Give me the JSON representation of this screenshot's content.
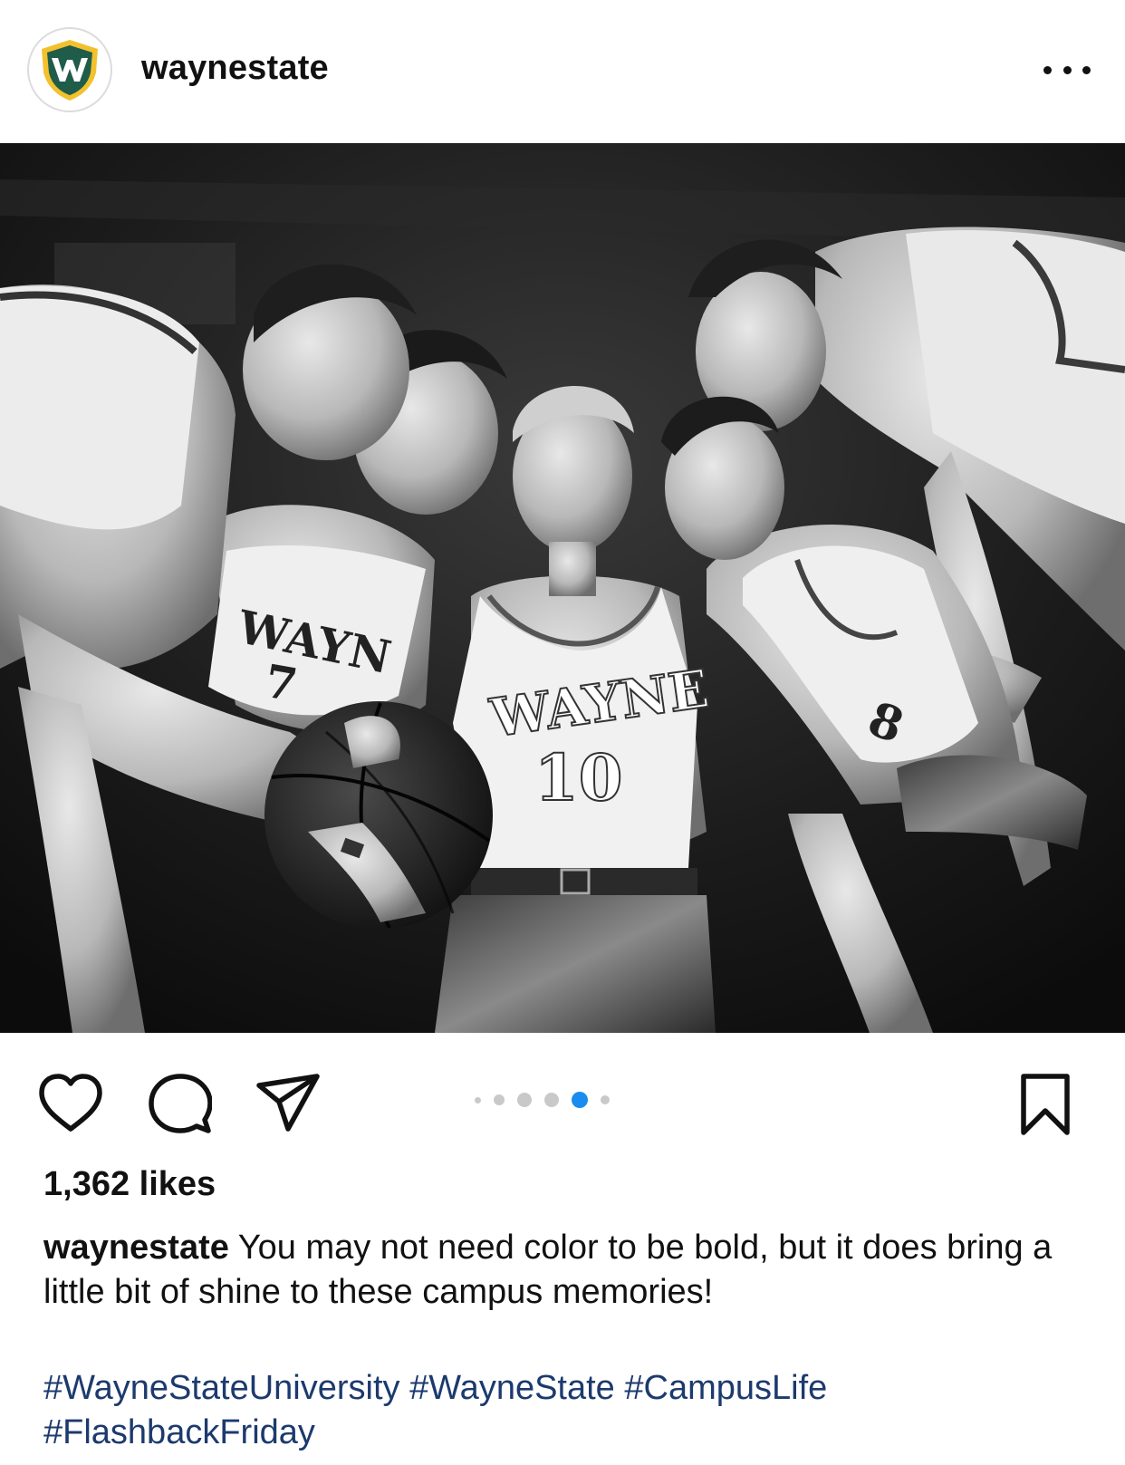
{
  "post": {
    "username": "waynestate",
    "avatar_icon": "wayne-state-w-shield-logo",
    "more_icon": "more-options-icon"
  },
  "photo": {
    "jersey_text_center": "WAYNE",
    "jersey_number_center": "10",
    "jersey_text_left": "WAYN",
    "jersey_number_left": "7",
    "jersey_number_right": "8"
  },
  "actions": {
    "like_icon": "heart-icon",
    "comment_icon": "comment-bubble-icon",
    "share_icon": "paper-plane-icon",
    "save_icon": "bookmark-icon",
    "carousel": {
      "total": 6,
      "active_index": 4
    },
    "active_dot_color": "#1a8cf0"
  },
  "likes": "1,362 likes",
  "caption": {
    "username": "waynestate",
    "text": "You may not need color to be bold, but it does bring a little bit of shine to these campus memories!"
  },
  "hashtags": [
    "#WayneStateUniversity",
    "#WayneState",
    "#CampusLife",
    "#FlashbackFriday"
  ],
  "colors": {
    "hashtag": "#1c3a6e",
    "logo_green": "#1f5c4a",
    "logo_gold": "#f2c12e"
  }
}
